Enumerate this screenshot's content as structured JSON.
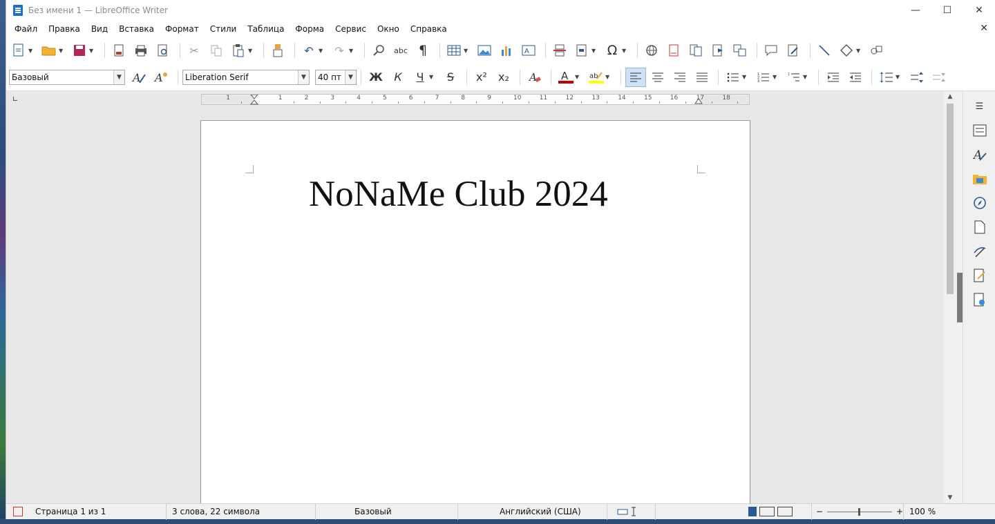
{
  "window": {
    "title": "Без имени 1 — LibreOffice Writer"
  },
  "window_controls": {
    "minimize": "—",
    "maximize": "☐",
    "close": "✕"
  },
  "menu": {
    "items": [
      "Файл",
      "Правка",
      "Вид",
      "Вставка",
      "Формат",
      "Стили",
      "Таблица",
      "Форма",
      "Сервис",
      "Окно",
      "Справка"
    ],
    "close_doc": "✕"
  },
  "formatting": {
    "paragraph_style": "Базовый",
    "font_name": "Liberation Serif",
    "font_size": "40 пт",
    "bold": "Ж",
    "italic": "К",
    "underline": "Ч",
    "strike": "S",
    "superscript": "x²",
    "subscript": "x₂",
    "font_color": "#c00000",
    "highlight_color": "#ffff00"
  },
  "ruler": {
    "labels": [
      "1",
      "1",
      "2",
      "3",
      "4",
      "5",
      "6",
      "7",
      "8",
      "9",
      "10",
      "11",
      "12",
      "13",
      "14",
      "15",
      "16",
      "17",
      "18"
    ]
  },
  "document": {
    "text": "NoNaMe Club 2024"
  },
  "status": {
    "page": "Страница 1 из 1",
    "words": "3 слова, 22 символа",
    "style": "Базовый",
    "language": "Английский (США)",
    "zoom": "100 %",
    "zoom_minus": "−",
    "zoom_plus": "+"
  }
}
